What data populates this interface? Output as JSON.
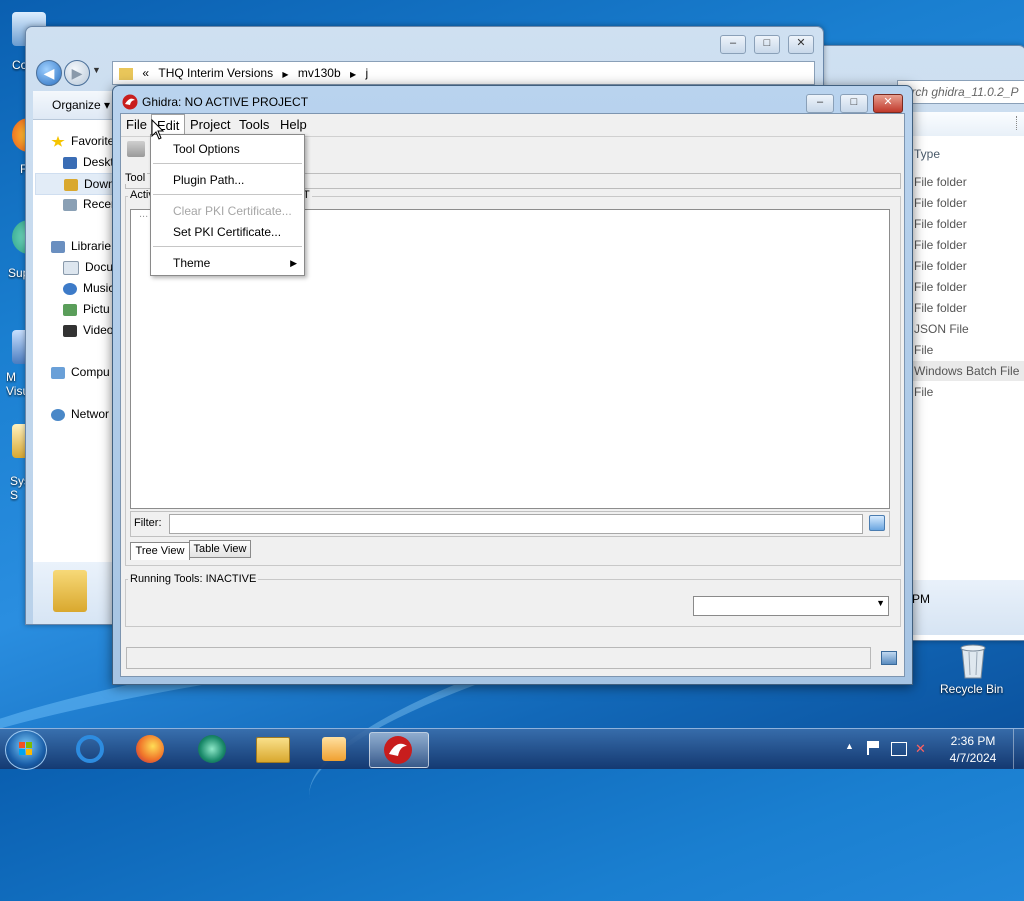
{
  "desktop": {
    "left_icon_labels": [
      "Co",
      "F",
      "Sup",
      "M\nVisu",
      "Sys\nS"
    ],
    "recycle_bin_label": "Recycle Bin"
  },
  "explorer": {
    "breadcrumb": [
      "«",
      "THQ Interim Versions",
      "mv130b",
      "j"
    ],
    "toolbar_organize": "Organize ▾",
    "nav_items": [
      {
        "label": "Favorite",
        "icon": "star-icon"
      },
      {
        "label": "Deskt",
        "icon": "desktop-icon"
      },
      {
        "label": "Down",
        "icon": "downloads-icon"
      },
      {
        "label": "Recer",
        "icon": "recent-places-icon"
      },
      {
        "label": "Librarie",
        "icon": "libraries-icon"
      },
      {
        "label": "Docu",
        "icon": "documents-icon"
      },
      {
        "label": "Music",
        "icon": "music-icon"
      },
      {
        "label": "Pictu",
        "icon": "pictures-icon"
      },
      {
        "label": "Video",
        "icon": "videos-icon"
      },
      {
        "label": "Compu",
        "icon": "computer-icon"
      },
      {
        "label": "Networ",
        "icon": "network-icon"
      }
    ]
  },
  "explorer2": {
    "search_placeholder": "earch ghidra_11.0.2_P",
    "type_header": "Type",
    "types": [
      "File folder",
      "File folder",
      "File folder",
      "File folder",
      "File folder",
      "File folder",
      "File folder",
      "JSON File",
      "File",
      "Windows Batch File",
      "File"
    ],
    "time_fragment": "PM"
  },
  "ghidra": {
    "title": "Ghidra: NO ACTIVE PROJECT",
    "menu": [
      "File",
      "Edit",
      "Project",
      "Tools",
      "Help"
    ],
    "tool_chest_label": "Tool",
    "active_project_label": "Activ",
    "active_project_label_tail": "T",
    "tree_placeholder": "...",
    "filter_label": "Filter:",
    "tab_tree": "Tree View",
    "tab_table": "Table View",
    "running_tools_label": "Running Tools: INACTIVE"
  },
  "edit_menu": {
    "items": [
      {
        "label": "Tool Options",
        "enabled": true
      },
      {
        "label": "Plugin Path...",
        "enabled": true
      },
      {
        "label": "Clear PKI Certificate...",
        "enabled": false
      },
      {
        "label": "Set PKI Certificate...",
        "enabled": true
      },
      {
        "label": "Theme",
        "enabled": true,
        "submenu": true
      }
    ]
  },
  "taskbar": {
    "apps": [
      "internet-explorer-icon",
      "firefox-icon",
      "media-center-icon",
      "file-explorer-icon",
      "media-player-icon",
      "ghidra-icon"
    ],
    "time": "2:36 PM",
    "date": "4/7/2024"
  }
}
